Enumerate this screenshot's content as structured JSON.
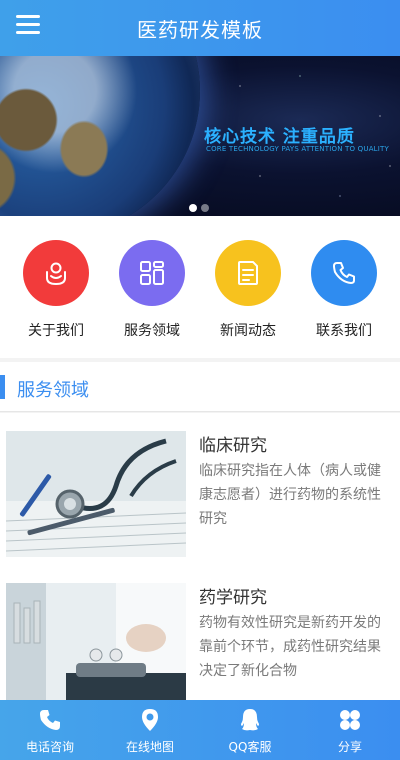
{
  "header": {
    "title": "医药研发模板",
    "menu_icon": "menu-icon"
  },
  "banner": {
    "title": "核心技术 注重品质",
    "subtitle": "CORE TECHNOLOGY PAYS ATTENTION TO QUALITY",
    "slides": 2,
    "active_slide": 1
  },
  "quick_nav": [
    {
      "label": "关于我们",
      "icon": "handshake-icon",
      "color": "#f23b3b"
    },
    {
      "label": "服务领域",
      "icon": "grid-icon",
      "color": "#7b6cf0"
    },
    {
      "label": "新闻动态",
      "icon": "document-icon",
      "color": "#f7c21e"
    },
    {
      "label": "联系我们",
      "icon": "phone-icon",
      "color": "#2f8cf0"
    }
  ],
  "section": {
    "title": "服务领域"
  },
  "articles": [
    {
      "title": "临床研究",
      "desc": "临床研究指在人体（病人或健康志愿者）进行药物的系统性研究"
    },
    {
      "title": "药学研究",
      "desc": "药物有效性研究是新药开发的靠前个环节，成药性研究结果决定了新化合物"
    }
  ],
  "bottom_nav": [
    {
      "label": "电话咨询",
      "icon": "phone-icon"
    },
    {
      "label": "在线地图",
      "icon": "map-pin-icon"
    },
    {
      "label": "QQ客服",
      "icon": "qq-icon"
    },
    {
      "label": "分享",
      "icon": "share-icon"
    }
  ],
  "colors": {
    "primary": "#3b8ef0",
    "header_gradient_start": "#3fa0ea"
  }
}
